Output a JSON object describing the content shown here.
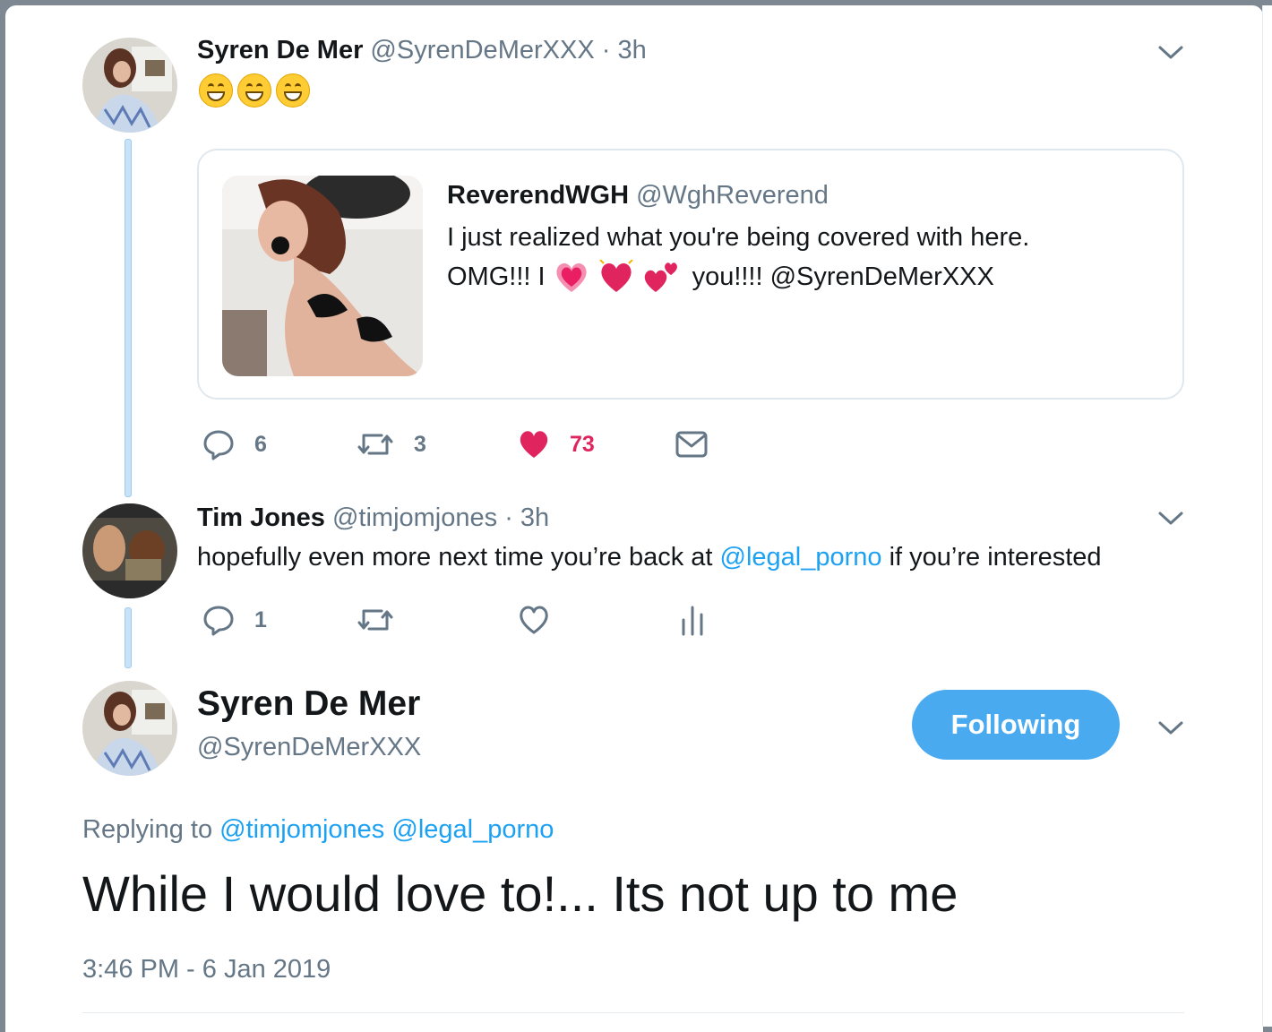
{
  "tweet1": {
    "name": "Syren De Mer",
    "handle": "@SyrenDeMerXXX",
    "sep": "·",
    "time": "3h",
    "emojis": [
      "grinning-face-with-smiling-eyes",
      "grinning-face-with-smiling-eyes",
      "grinning-face-with-smiling-eyes"
    ],
    "quote": {
      "name": "ReverendWGH",
      "handle": "@WghReverend",
      "line1": "I just realized what you're being covered with here.",
      "line2_pre": "OMG!!! I",
      "line2_post": "you!!!! @SyrenDeMerXXX",
      "emojis": [
        "growing-heart",
        "beating-heart",
        "two-hearts"
      ]
    },
    "replies": "6",
    "retweets": "3",
    "likes": "73"
  },
  "tweet2": {
    "name": "Tim Jones",
    "handle": "@timjomjones",
    "sep": "·",
    "time": "3h",
    "text_pre": "hopefully even more next time you’re back at",
    "mention": "@legal_porno",
    "text_post": "if you’re interested",
    "replies": "1"
  },
  "main": {
    "name": "Syren De Mer",
    "handle": "@SyrenDeMerXXX",
    "follow_label": "Following",
    "replying_label": "Replying to",
    "replying_to": [
      "@timjomjones",
      "@legal_porno"
    ],
    "text": "While I would love to!... Its not up to me",
    "timestamp": "3:46 PM - 6 Jan 2019"
  },
  "colors": {
    "accent": "#1da1f2",
    "like": "#e0245e",
    "muted": "#657786",
    "follow_bg": "#4aaaf0"
  }
}
